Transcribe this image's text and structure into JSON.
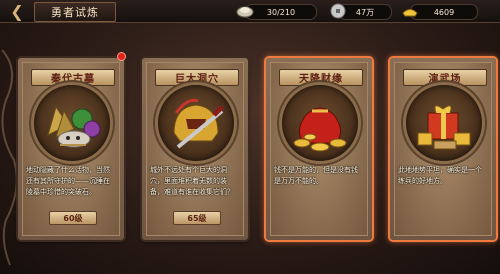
{
  "topbar": {
    "title": "勇者试炼",
    "resources": [
      {
        "icon": "stamina-icon",
        "value": "30/210"
      },
      {
        "icon": "silver-coin-icon",
        "value": "47万"
      },
      {
        "icon": "gold-ingot-icon",
        "value": "4609"
      }
    ]
  },
  "cards": [
    {
      "title": "秦代古墓",
      "image": "armor-skull-treasure",
      "description": "地动隐藏了什么活物，当然还有其所守护的——沉睡在陵墓中珍惜的突破石。",
      "level": "60级",
      "selected": false,
      "notification": true
    },
    {
      "title": "巨大洞穴",
      "image": "golden-helmet-sword",
      "description": "城外不远处有个巨大的洞穴，里面堆积着无数的装备，难道有谁在收集它们？",
      "level": "65级",
      "selected": false,
      "notification": false
    },
    {
      "title": "天降财缘",
      "image": "red-money-bag-coins",
      "description": "钱不是万能的，但是没有钱是万万不能的。",
      "level": "",
      "selected": true,
      "notification": false
    },
    {
      "title": "演武场",
      "image": "gift-box-scrolls",
      "description": "此地地势平坦，确实是一个练兵的好地方。",
      "level": "",
      "selected": true,
      "notification": false
    }
  ],
  "colors": {
    "selected_glow": "#ee7a40",
    "title_text": "#5c1e10"
  }
}
